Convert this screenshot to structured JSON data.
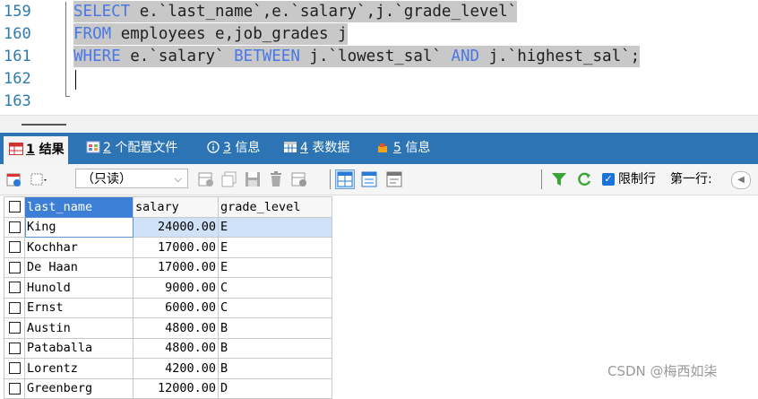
{
  "editor": {
    "line_numbers": [
      "159",
      "160",
      "161",
      "162",
      "163"
    ],
    "lines": [
      [
        {
          "t": "SELECT",
          "kw": true
        },
        {
          "t": " e.`last_name`,e.`salary`,j.`grade_level`",
          "kw": false
        }
      ],
      [
        {
          "t": "FROM",
          "kw": true
        },
        {
          "t": " employees e,job_grades j",
          "kw": false
        }
      ],
      [
        {
          "t": "WHERE",
          "kw": true
        },
        {
          "t": " e.`salary` ",
          "kw": false
        },
        {
          "t": "BETWEEN",
          "kw": true
        },
        {
          "t": " j.`lowest_sal` ",
          "kw": false
        },
        {
          "t": "AND",
          "kw": true
        },
        {
          "t": " j.`highest_sal`;",
          "kw": false
        }
      ]
    ]
  },
  "tabs": [
    {
      "num": "1",
      "label": "结果",
      "icon": "grid-icon",
      "active": true
    },
    {
      "num": "2",
      "label": "个配置文件",
      "icon": "profile-icon"
    },
    {
      "num": "3",
      "label": "信息",
      "icon": "info-icon"
    },
    {
      "num": "4",
      "label": "表数据",
      "icon": "table-icon"
    },
    {
      "num": "5",
      "label": "信息",
      "icon": "info-folder-icon"
    }
  ],
  "toolbar": {
    "readonly_value": "（只读）",
    "limit_rows_label": "限制行",
    "first_row_label": "第一行:",
    "limit_rows_checked": true
  },
  "grid": {
    "columns": [
      "last_name",
      "salary",
      "grade_level"
    ],
    "rows": [
      [
        "King",
        "24000.00",
        "E"
      ],
      [
        "Kochhar",
        "17000.00",
        "E"
      ],
      [
        "De Haan",
        "17000.00",
        "E"
      ],
      [
        "Hunold",
        "9000.00",
        "C"
      ],
      [
        "Ernst",
        "6000.00",
        "C"
      ],
      [
        "Austin",
        "4800.00",
        "B"
      ],
      [
        "Pataballa",
        "4800.00",
        "B"
      ],
      [
        "Lorentz",
        "4200.00",
        "B"
      ],
      [
        "Greenberg",
        "12000.00",
        "D"
      ]
    ]
  },
  "watermark": "CSDN @梅西如柒",
  "colors": {
    "keyword": "#4a77e6",
    "line_number": "#2b7bb0",
    "tab_bar": "#2c74b4",
    "selection": "#c8c8c8"
  }
}
